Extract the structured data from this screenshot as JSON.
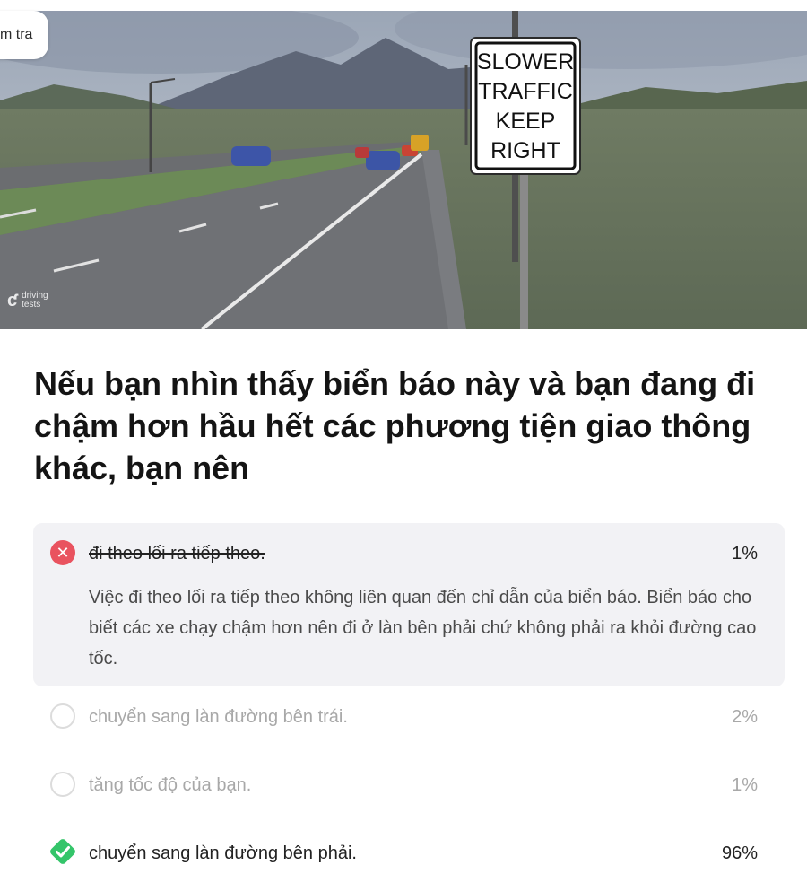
{
  "header": {
    "back_pill_label": "m tra",
    "brand": {
      "mark": "ƈ",
      "name": "driving tests"
    }
  },
  "sign": {
    "lines": [
      "SLOWER",
      "TRAFFIC",
      "KEEP",
      "RIGHT"
    ]
  },
  "question": "Nếu bạn nhìn thấy biển báo này và bạn đang đi chậm hơn hầu hết các phương tiện giao thông khác, bạn nên",
  "answers": [
    {
      "text": "đi theo lối ra tiếp theo.",
      "percent": "1%",
      "state": "selected-wrong",
      "explanation": "Việc đi theo lối ra tiếp theo không liên quan đến chỉ dẫn của biển báo. Biển báo cho biết các xe chạy chậm hơn nên đi ở làn bên phải chứ không phải ra khỏi đường cao tốc."
    },
    {
      "text": "chuyển sang làn đường bên trái.",
      "percent": "2%",
      "state": "unselected"
    },
    {
      "text": "tăng tốc độ của bạn.",
      "percent": "1%",
      "state": "unselected"
    },
    {
      "text": "chuyển sang làn đường bên phải.",
      "percent": "96%",
      "state": "correct"
    }
  ],
  "colors": {
    "wrong": "#e9535f",
    "correct": "#34c56a",
    "selected_bg": "#f2f2f5"
  },
  "icons": {
    "wrong": "x-circle-icon",
    "empty": "radio-empty-icon",
    "correct": "check-diamond-icon"
  }
}
